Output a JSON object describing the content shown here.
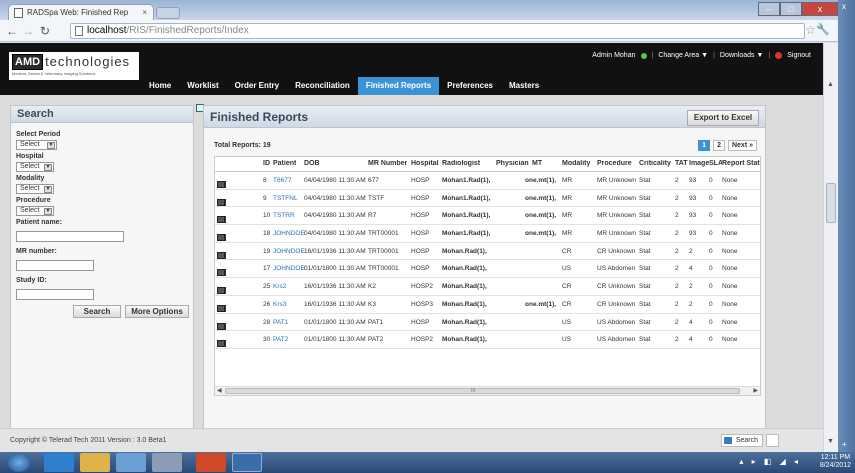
{
  "browser": {
    "tab_title": "RADSpa Web: Finished Rep",
    "tab_close": "×",
    "url_host": "localhost",
    "url_path": "/RIS/FinishedReports/Index",
    "win_min": "–",
    "win_max": "□",
    "win_close": "x"
  },
  "header": {
    "logo_mark": "AMD",
    "logo_text": "technologies",
    "logo_sub": "Medical, Dental & Veterinary Imaging Solutions",
    "user_label": "Admin Mohan",
    "change_area": "Change Area ▼",
    "downloads": "Downloads ▼",
    "signout": "Signout",
    "sep": "|"
  },
  "nav": [
    "Home",
    "Worklist",
    "Order Entry",
    "Reconciliation",
    "Finished Reports",
    "Preferences",
    "Masters"
  ],
  "search": {
    "title": "Search",
    "select_period_label": "Select Period",
    "select_period_value": "Select",
    "hospital_label": "Hospital",
    "hospital_value": "Select",
    "modality_label": "Modality",
    "modality_value": "Select",
    "procedure_label": "Procedure",
    "procedure_value": "Select",
    "patient_name_label": "Patient name:",
    "mr_number_label": "MR number:",
    "study_id_label": "Study ID:",
    "search_button": "Search",
    "more_options_button": "More Options"
  },
  "reports": {
    "title": "Finished Reports",
    "export_button": "Export to Excel",
    "total_label": "Total Reports: 19",
    "pages": [
      "1",
      "2"
    ],
    "next": "Next »",
    "scroll_mark": "III",
    "columns": [
      "ID",
      "Patient",
      "DOB",
      "MR Number",
      "Hospital",
      "Radiologist",
      "Physician",
      "MT",
      "Modality",
      "Procedure",
      "Criticality",
      "TAT",
      "Image#",
      "SLA",
      "Report Status"
    ],
    "rows": [
      [
        "8",
        "T6677",
        "04/04/1980 11:30:AM",
        "677",
        "HOSP",
        "Mohan1.Rad(1),",
        "",
        "one.mt(1),",
        "MR",
        "MR Unknown",
        "Stat",
        "2",
        "93",
        "0",
        "None"
      ],
      [
        "9",
        "TSTFNL",
        "04/04/1980 11:30:AM",
        "TSTF",
        "HOSP",
        "Mohan1.Rad(1),",
        "",
        "one.mt(1),",
        "MR",
        "MR Unknown",
        "Stat",
        "2",
        "93",
        "0",
        "None"
      ],
      [
        "10",
        "TSTRR",
        "04/04/1980 11:30:AM",
        "R7",
        "HOSP",
        "Mohan1.Rad(1),",
        "",
        "one.mt(1),",
        "MR",
        "MR Unknown",
        "Stat",
        "2",
        "93",
        "0",
        "None"
      ],
      [
        "18",
        "JOHNDOE",
        "04/04/1980 11:30:AM",
        "TRT00001",
        "HOSP",
        "Mohan1.Rad(1),",
        "",
        "one.mt(1),",
        "MR",
        "MR Unknown",
        "Stat",
        "2",
        "93",
        "0",
        "None"
      ],
      [
        "19",
        "JOHNDOE",
        "16/01/1936 11:30:AM",
        "TRT00001",
        "HOSP",
        "Mohan.Rad(1),",
        "",
        "",
        "CR",
        "CR Unknown",
        "Stat",
        "2",
        "2",
        "0",
        "None"
      ],
      [
        "17",
        "JOHNDOE",
        "01/01/1800 11:30:AM",
        "TRT00001",
        "HOSP",
        "Mohan.Rad(1),",
        "",
        "",
        "US",
        "US Abdomen",
        "Stat",
        "2",
        "4",
        "0",
        "None"
      ],
      [
        "25",
        "Krs2",
        "16/01/1936 11:30:AM",
        "K2",
        "HOSP2",
        "Mohan.Rad(1),",
        "",
        "",
        "CR",
        "CR Unknown",
        "Stat",
        "2",
        "2",
        "0",
        "None"
      ],
      [
        "26",
        "Krs3",
        "16/01/1936 11:30:AM",
        "K3",
        "HOSP3",
        "Mohan.Rad(1),",
        "",
        "one.mt(1),",
        "CR",
        "CR Unknown",
        "Stat",
        "2",
        "2",
        "0",
        "None"
      ],
      [
        "28",
        "PAT1",
        "01/01/1800 11:30:AM",
        "PAT1",
        "HOSP",
        "Mohan.Rad(1),",
        "",
        "",
        "US",
        "US Abdomen",
        "Stat",
        "2",
        "4",
        "0",
        "None"
      ],
      [
        "30",
        "PAT2",
        "01/01/1800 11:30:AM",
        "PAT2",
        "HOSP2",
        "Mohan.Rad(1),",
        "",
        "",
        "US",
        "US Abdomen",
        "Stat",
        "2",
        "4",
        "0",
        "None"
      ]
    ]
  },
  "footer": {
    "copyright": "Copyright © Telerad Tech 2011 Version : 3.0 Beta1",
    "search": "Search"
  },
  "taskbar": {
    "time": "12:11 PM",
    "date": "8/24/2012"
  }
}
